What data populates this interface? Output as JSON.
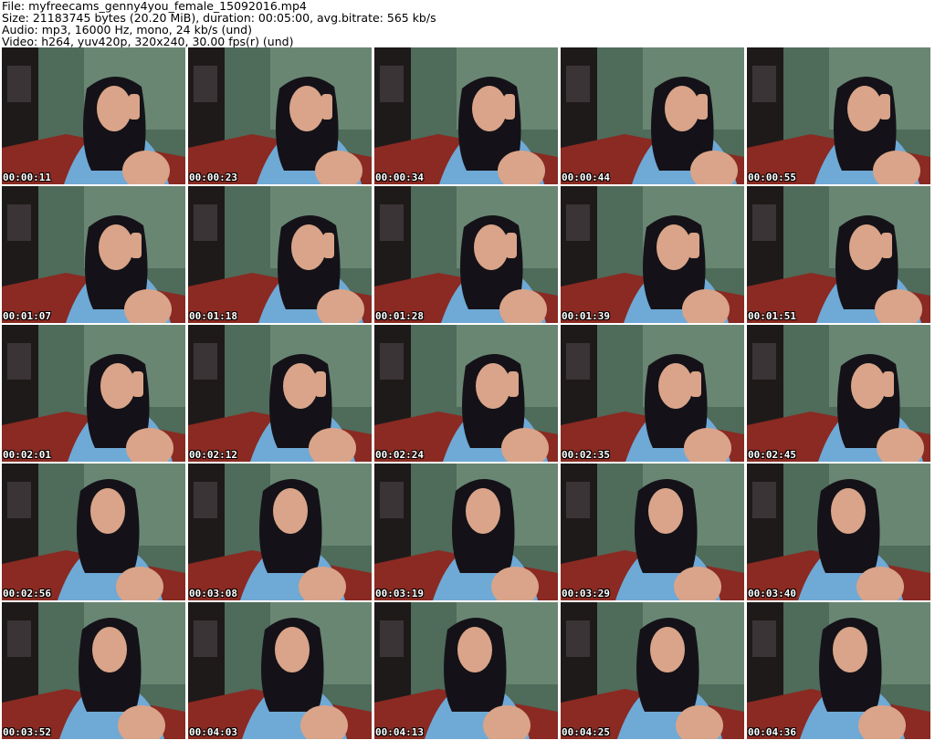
{
  "header": {
    "file_line": "File: myfreecams_genny4you_female_15092016.mp4",
    "size_line": "Size: 21183745 bytes (20.20 MiB), duration: 00:05:00, avg.bitrate: 565 kb/s",
    "audio_line": "Audio: mp3, 16000 Hz, mono, 24 kb/s (und)",
    "video_line": "Video: h264, yuv420p, 320x240, 30.00 fps(r) (und)"
  },
  "thumbnails": [
    {
      "timestamp": "00:00:11"
    },
    {
      "timestamp": "00:00:23"
    },
    {
      "timestamp": "00:00:34"
    },
    {
      "timestamp": "00:00:44"
    },
    {
      "timestamp": "00:00:55"
    },
    {
      "timestamp": "00:01:07"
    },
    {
      "timestamp": "00:01:18"
    },
    {
      "timestamp": "00:01:28"
    },
    {
      "timestamp": "00:01:39"
    },
    {
      "timestamp": "00:01:51"
    },
    {
      "timestamp": "00:02:01"
    },
    {
      "timestamp": "00:02:12"
    },
    {
      "timestamp": "00:02:24"
    },
    {
      "timestamp": "00:02:35"
    },
    {
      "timestamp": "00:02:45"
    },
    {
      "timestamp": "00:02:56"
    },
    {
      "timestamp": "00:03:08"
    },
    {
      "timestamp": "00:03:19"
    },
    {
      "timestamp": "00:03:29"
    },
    {
      "timestamp": "00:03:40"
    },
    {
      "timestamp": "00:03:52"
    },
    {
      "timestamp": "00:04:03"
    },
    {
      "timestamp": "00:04:13"
    },
    {
      "timestamp": "00:04:25"
    },
    {
      "timestamp": "00:04:36"
    }
  ],
  "colors": {
    "wall": "#4f6b5a",
    "wall_light": "#7f9c86",
    "furniture": "#1e1a1a",
    "floor_red": "#8a2a22",
    "dress": "#6fa9d6",
    "skin": "#d9a489",
    "hair": "#141218"
  }
}
